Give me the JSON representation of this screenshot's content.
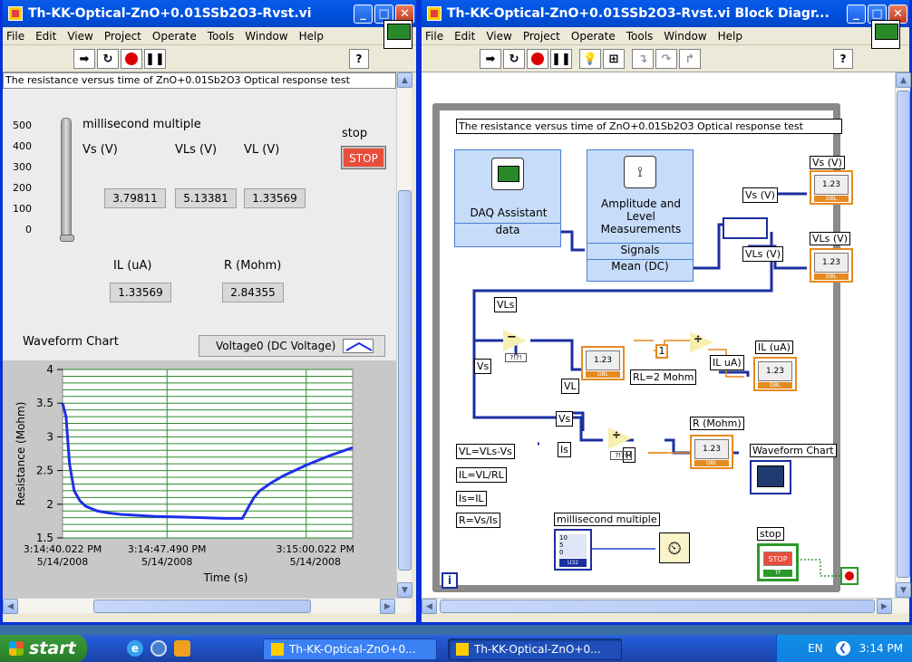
{
  "front_panel": {
    "title": "Th-KK-Optical-ZnO+0.01SSb2O3-Rvst.vi",
    "menu": [
      "File",
      "Edit",
      "View",
      "Project",
      "Operate",
      "Tools",
      "Window",
      "Help"
    ],
    "banner": "The resistance versus time of ZnO+0.01Sb2O3 Optical response test",
    "slider_label": "millisecond multiple",
    "slider_ticks": [
      "500",
      "400",
      "300",
      "200",
      "100",
      "0"
    ],
    "stop_label": "stop",
    "stop_button": "STOP",
    "vs_label": "Vs (V)",
    "vs_value": "3.79811",
    "vls_label": "VLs (V)",
    "vls_value": "5.13381",
    "vl_label": "VL (V)",
    "vl_value": "1.33569",
    "il_label": "IL (uA)",
    "il_value": "1.33569",
    "r_label": "R (Mohm)",
    "r_value": "2.84355",
    "chart_label": "Waveform Chart",
    "legend": "Voltage0 (DC Voltage)"
  },
  "chart_data": {
    "type": "line",
    "title": "",
    "xlabel": "Time (s)",
    "ylabel": "Resistance (Mohm)",
    "ylim": [
      1.5,
      4
    ],
    "yticks": [
      "4",
      "3.5",
      "3",
      "2.5",
      "2",
      "1.5"
    ],
    "xticks": [
      {
        "time": "3:14:40.022 PM",
        "date": "5/14/2008"
      },
      {
        "time": "3:14:47.490 PM",
        "date": "5/14/2008"
      },
      {
        "time": "3:15:00.022 PM",
        "date": "5/14/2008"
      }
    ],
    "series": [
      {
        "name": "Voltage0 (DC Voltage)",
        "color": "#1f2fe8",
        "x": [
          0,
          0.3,
          0.6,
          1,
          1.5,
          2,
          3,
          4,
          5,
          6,
          8,
          10,
          12,
          14,
          15.5,
          16,
          16.5,
          17,
          18,
          19,
          20,
          21,
          22,
          23,
          24,
          25
        ],
        "y": [
          3.5,
          3.3,
          2.6,
          2.2,
          2.05,
          1.97,
          1.9,
          1.87,
          1.85,
          1.84,
          1.82,
          1.81,
          1.8,
          1.79,
          1.79,
          1.95,
          2.1,
          2.2,
          2.32,
          2.42,
          2.5,
          2.58,
          2.65,
          2.72,
          2.78,
          2.84
        ]
      }
    ],
    "grid": true
  },
  "block_diagram": {
    "title": "Th-KK-Optical-ZnO+0.01SSb2O3-Rvst.vi Block Diagr...",
    "menu": [
      "File",
      "Edit",
      "View",
      "Project",
      "Operate",
      "Tools",
      "Window",
      "Help"
    ],
    "banner": "The resistance versus time of ZnO+0.01Sb2O3 Optical response test",
    "daq_title": "DAQ Assistant",
    "daq_out": "data",
    "amp_title": "Amplitude and Level Measurements",
    "amp_in": "Signals",
    "amp_out": "Mean (DC)",
    "vs_label": "Vs (V)",
    "vls_label": "VLs (V)",
    "il_label": "IL (uA)",
    "r_label": "R (Mohm)",
    "wf_label": "Waveform Chart",
    "ms_label": "millisecond multiple",
    "stop_label": "stop",
    "stop_text": "STOP",
    "tag_vs_v": "Vs (V)",
    "tag_vls_v": "VLs (V)",
    "tag_vls": "VLs",
    "tag_vs": "Vs",
    "tag_vl": "VL",
    "tag_il_ua": "IL uA)",
    "tag_vs2": "Vs",
    "tag_is": "Is",
    "tag_r": "R",
    "const_1": "1",
    "rl_note": "RL=2 Mohm",
    "eq1": "VL=VLs-Vs",
    "eq2": "IL=VL/RL",
    "eq3": "Is=IL",
    "eq4": "R=Vs/Is",
    "num_display": "1.23",
    "dbl": "DBL",
    "u32": "U32",
    "tf": "TF",
    "info": "i"
  },
  "taskbar": {
    "start": "start",
    "task1": "Th-KK-Optical-ZnO+0...",
    "task2": "Th-KK-Optical-ZnO+0...",
    "lang": "EN",
    "clock": "3:14 PM"
  }
}
